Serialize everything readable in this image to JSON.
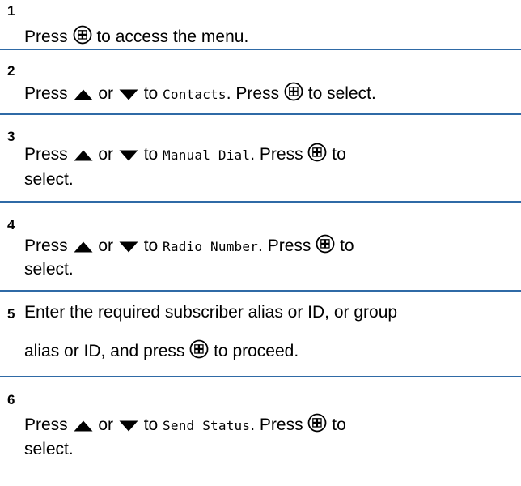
{
  "steps": [
    {
      "number": "1",
      "lines": [
        [
          {
            "t": "text",
            "v": "Press "
          },
          {
            "t": "icon",
            "v": "menu-ok-button-icon"
          },
          {
            "t": "text",
            "v": " to access the menu."
          }
        ]
      ]
    },
    {
      "number": "2",
      "lines": [
        [
          {
            "t": "text",
            "v": "Press "
          },
          {
            "t": "icon",
            "v": "up-arrow-icon"
          },
          {
            "t": "text",
            "v": " or "
          },
          {
            "t": "icon",
            "v": "down-arrow-icon"
          },
          {
            "t": "text",
            "v": " to "
          },
          {
            "t": "mono",
            "v": "Contacts"
          },
          {
            "t": "text",
            "v": ". Press "
          },
          {
            "t": "icon",
            "v": "menu-ok-button-icon"
          },
          {
            "t": "text",
            "v": " to select."
          }
        ]
      ]
    },
    {
      "number": "3",
      "lines": [
        [
          {
            "t": "text",
            "v": "Press "
          },
          {
            "t": "icon",
            "v": "up-arrow-icon"
          },
          {
            "t": "text",
            "v": " or "
          },
          {
            "t": "icon",
            "v": "down-arrow-icon"
          },
          {
            "t": "text",
            "v": " to "
          },
          {
            "t": "mono",
            "v": "Manual Dial"
          },
          {
            "t": "text",
            "v": ". Press "
          },
          {
            "t": "icon",
            "v": "menu-ok-button-icon"
          },
          {
            "t": "text",
            "v": " to"
          }
        ],
        [
          {
            "t": "text",
            "v": "select."
          }
        ]
      ]
    },
    {
      "number": "4",
      "lines": [
        [
          {
            "t": "text",
            "v": "Press "
          },
          {
            "t": "icon",
            "v": "up-arrow-icon"
          },
          {
            "t": "text",
            "v": " or "
          },
          {
            "t": "icon",
            "v": "down-arrow-icon"
          },
          {
            "t": "text",
            "v": " to "
          },
          {
            "t": "mono",
            "v": "Radio Number"
          },
          {
            "t": "text",
            "v": ". Press "
          },
          {
            "t": "icon",
            "v": "menu-ok-button-icon"
          },
          {
            "t": "text",
            "v": " to"
          }
        ],
        [
          {
            "t": "text",
            "v": "select."
          }
        ]
      ]
    },
    {
      "number": "5",
      "lines": [
        [
          {
            "t": "text",
            "v": "Enter the required subscriber alias or ID, or group"
          }
        ],
        [
          {
            "t": "text",
            "v": "alias or ID, and press "
          },
          {
            "t": "icon",
            "v": "menu-ok-button-icon"
          },
          {
            "t": "text",
            "v": " to proceed."
          }
        ]
      ]
    },
    {
      "number": "6",
      "lines": [
        [
          {
            "t": "text",
            "v": "Press "
          },
          {
            "t": "icon",
            "v": "up-arrow-icon"
          },
          {
            "t": "text",
            "v": " or "
          },
          {
            "t": "icon",
            "v": "down-arrow-icon"
          },
          {
            "t": "text",
            "v": " to "
          },
          {
            "t": "mono",
            "v": "Send Status"
          },
          {
            "t": "text",
            "v": ". Press "
          },
          {
            "t": "icon",
            "v": "menu-ok-button-icon"
          },
          {
            "t": "text",
            "v": " to"
          }
        ],
        [
          {
            "t": "text",
            "v": "select."
          }
        ]
      ]
    }
  ],
  "colors": {
    "divider": "#2f6aa6",
    "text": "#000000"
  }
}
